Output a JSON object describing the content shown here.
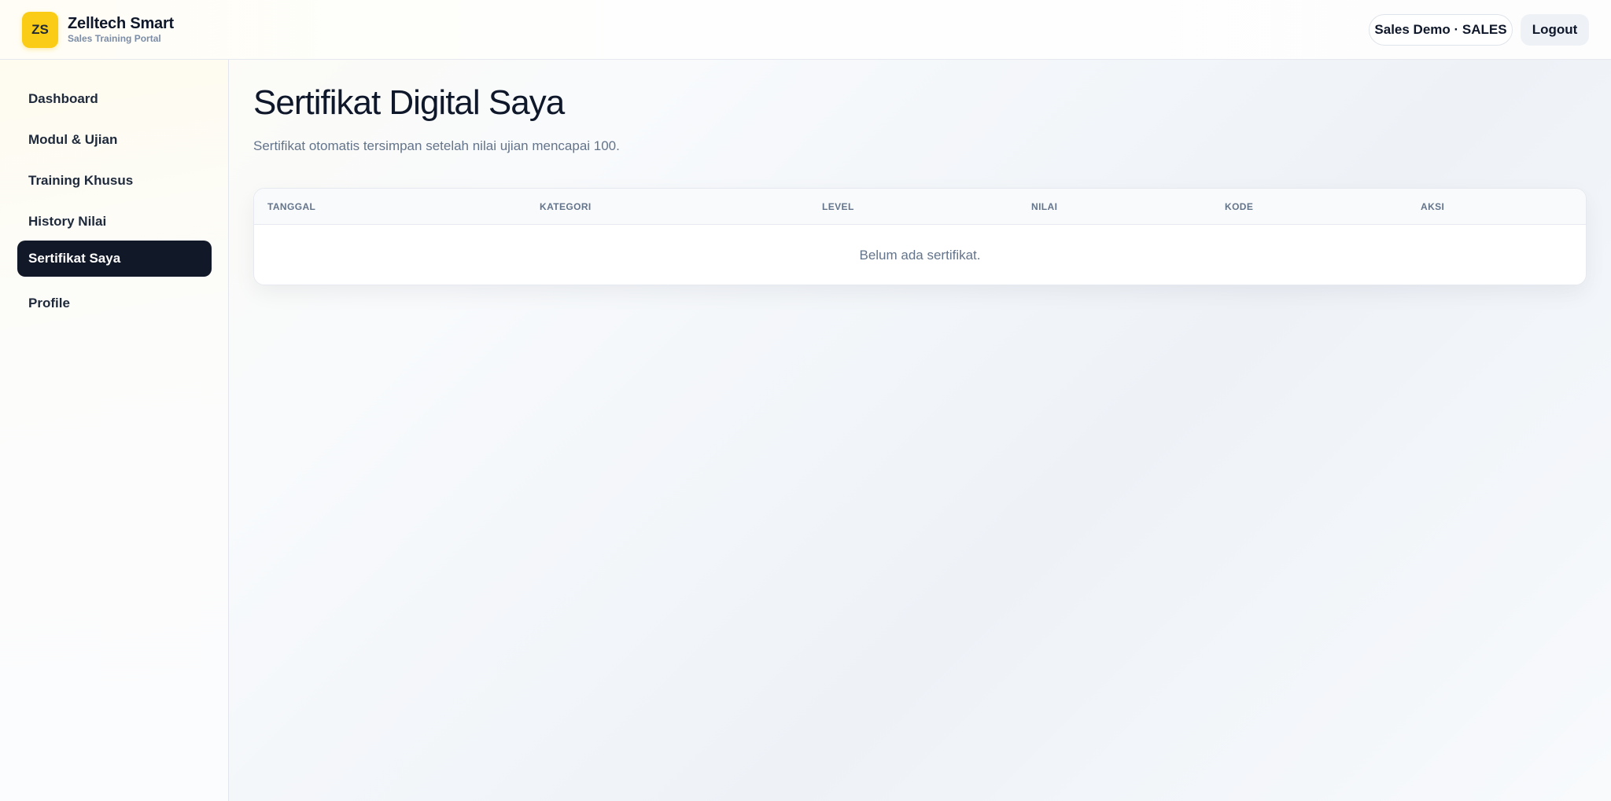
{
  "brand": {
    "badge": "ZS",
    "title": "Zelltech Smart",
    "subtitle": "Sales Training Portal"
  },
  "header": {
    "user_label": "Sales Demo · SALES",
    "logout_label": "Logout"
  },
  "sidebar": {
    "items": [
      {
        "label": "Dashboard"
      },
      {
        "label": "Modul & Ujian"
      },
      {
        "label": "Training Khusus"
      },
      {
        "label": "History Nilai"
      },
      {
        "label": "Sertifikat Saya",
        "active": true
      },
      {
        "label": "Profile"
      }
    ]
  },
  "main": {
    "title": "Sertifikat Digital Saya",
    "description": "Sertifikat otomatis tersimpan setelah nilai ujian mencapai 100.",
    "table": {
      "columns": [
        "TANGGAL",
        "KATEGORI",
        "LEVEL",
        "NILAI",
        "KODE",
        "AKSI"
      ],
      "rows": [],
      "empty_message": "Belum ada sertifikat."
    }
  },
  "colors": {
    "accent": "#facc15",
    "active_nav": "#111827",
    "muted_text": "#64748b"
  }
}
